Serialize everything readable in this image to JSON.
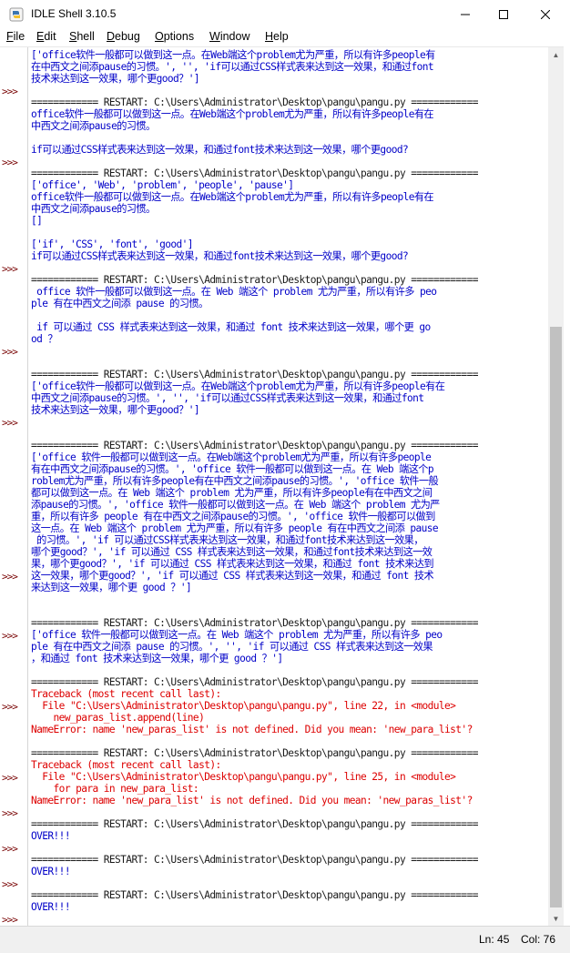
{
  "window": {
    "title": "IDLE Shell 3.10.5"
  },
  "window_controls": {
    "minimize": "—",
    "maximize": "☐",
    "close": "✕"
  },
  "menu": [
    {
      "label": "File",
      "key": "F",
      "rest": "ile"
    },
    {
      "label": "Edit",
      "key": "E",
      "rest": "dit"
    },
    {
      "label": "Shell",
      "key": "S",
      "rest": "hell"
    },
    {
      "label": "Debug",
      "key": "D",
      "rest": "ebug"
    },
    {
      "label": "Options",
      "key": "O",
      "rest": "ptions"
    },
    {
      "label": "Window",
      "key": "W",
      "rest": "indow"
    },
    {
      "label": "Help",
      "key": "H",
      "rest": "elp"
    }
  ],
  "prompt_symbol": ">>>",
  "prompts": [
    1,
    2,
    3,
    4,
    5,
    6,
    7,
    8,
    9,
    10,
    11,
    12,
    13,
    14,
    15,
    16
  ],
  "lines": [
    {
      "c": "blue",
      "t": "['office软件一般都可以做到这一点。在Web端这个problem尤为严重，所以有许多people有"
    },
    {
      "c": "blue",
      "t": "在中西文之间添pause的习惯。', '', 'if可以通过CSS样式表来达到这一效果，和通过font"
    },
    {
      "c": "blue",
      "t": "技术来达到这一效果，哪个更good？']"
    },
    {
      "c": "black",
      "t": ""
    },
    {
      "c": "black",
      "t": "============ RESTART: C:\\Users\\Administrator\\Desktop\\pangu\\pangu.py ============"
    },
    {
      "c": "blue",
      "t": "office软件一般都可以做到这一点。在Web端这个problem尤为严重，所以有许多people有在"
    },
    {
      "c": "blue",
      "t": "中西文之间添pause的习惯。"
    },
    {
      "c": "blue",
      "t": ""
    },
    {
      "c": "blue",
      "t": "if可以通过CSS样式表来达到这一效果，和通过font技术来达到这一效果，哪个更good?"
    },
    {
      "c": "black",
      "t": ""
    },
    {
      "c": "black",
      "t": "============ RESTART: C:\\Users\\Administrator\\Desktop\\pangu\\pangu.py ============"
    },
    {
      "c": "blue",
      "t": "['office', 'Web', 'problem', 'people', 'pause']"
    },
    {
      "c": "blue",
      "t": "office软件一般都可以做到这一点。在Web端这个problem尤为严重，所以有许多people有在"
    },
    {
      "c": "blue",
      "t": "中西文之间添pause的习惯。"
    },
    {
      "c": "blue",
      "t": "[]"
    },
    {
      "c": "blue",
      "t": ""
    },
    {
      "c": "blue",
      "t": "['if', 'CSS', 'font', 'good']"
    },
    {
      "c": "blue",
      "t": "if可以通过CSS样式表来达到这一效果，和通过font技术来达到这一效果，哪个更good?"
    },
    {
      "c": "black",
      "t": ""
    },
    {
      "c": "black",
      "t": "============ RESTART: C:\\Users\\Administrator\\Desktop\\pangu\\pangu.py ============"
    },
    {
      "c": "blue",
      "t": " office 软件一般都可以做到这一点。在 Web 端这个 problem 尤为严重，所以有许多 peo"
    },
    {
      "c": "blue",
      "t": "ple 有在中西文之间添 pause 的习惯。"
    },
    {
      "c": "blue",
      "t": ""
    },
    {
      "c": "blue",
      "t": " if 可以通过 CSS 样式表来达到这一效果，和通过 font 技术来达到这一效果，哪个更 go"
    },
    {
      "c": "blue",
      "t": "od ？"
    },
    {
      "c": "black",
      "t": ""
    },
    {
      "c": "black",
      "t": ""
    },
    {
      "c": "black",
      "t": "============ RESTART: C:\\Users\\Administrator\\Desktop\\pangu\\pangu.py ============"
    },
    {
      "c": "blue",
      "t": "['office软件一般都可以做到这一点。在Web端这个problem尤为严重，所以有许多people有在"
    },
    {
      "c": "blue",
      "t": "中西文之间添pause的习惯。', '', 'if可以通过CSS样式表来达到这一效果，和通过font"
    },
    {
      "c": "blue",
      "t": "技术来达到这一效果，哪个更good？']"
    },
    {
      "c": "black",
      "t": ""
    },
    {
      "c": "black",
      "t": ""
    },
    {
      "c": "black",
      "t": "============ RESTART: C:\\Users\\Administrator\\Desktop\\pangu\\pangu.py ============"
    },
    {
      "c": "blue",
      "t": "['office 软件一般都可以做到这一点。在Web端这个problem尤为严重，所以有许多people"
    },
    {
      "c": "blue",
      "t": "有在中西文之间添pause的习惯。', 'office 软件一般都可以做到这一点。在 Web 端这个p"
    },
    {
      "c": "blue",
      "t": "roblem尤为严重，所以有许多people有在中西文之间添pause的习惯。', 'office 软件一般"
    },
    {
      "c": "blue",
      "t": "都可以做到这一点。在 Web 端这个 problem 尤为严重，所以有许多people有在中西文之间"
    },
    {
      "c": "blue",
      "t": "添pause的习惯。', 'office 软件一般都可以做到这一点。在 Web 端这个 problem 尤为严"
    },
    {
      "c": "blue",
      "t": "重，所以有许多 people 有在中西文之间添pause的习惯。', 'office 软件一般都可以做到"
    },
    {
      "c": "blue",
      "t": "这一点。在 Web 端这个 problem 尤为严重，所以有许多 people 有在中西文之间添 pause"
    },
    {
      "c": "blue",
      "t": " 的习惯。', 'if 可以通过CSS样式表来达到这一效果，和通过font技术来达到这一效果，"
    },
    {
      "c": "blue",
      "t": "哪个更good？', 'if 可以通过 CSS 样式表来达到这一效果，和通过font技术来达到这一效"
    },
    {
      "c": "blue",
      "t": "果，哪个更good？', 'if 可以通过 CSS 样式表来达到这一效果，和通过 font 技术来达到"
    },
    {
      "c": "blue",
      "t": "这一效果，哪个更good？', 'if 可以通过 CSS 样式表来达到这一效果，和通过 font 技术"
    },
    {
      "c": "blue",
      "t": "来达到这一效果，哪个更 good ？']"
    },
    {
      "c": "black",
      "t": ""
    },
    {
      "c": "black",
      "t": ""
    },
    {
      "c": "black",
      "t": "============ RESTART: C:\\Users\\Administrator\\Desktop\\pangu\\pangu.py ============"
    },
    {
      "c": "blue",
      "t": "['office 软件一般都可以做到这一点。在 Web 端这个 problem 尤为严重，所以有许多 peo"
    },
    {
      "c": "blue",
      "t": "ple 有在中西文之间添 pause 的习惯。', '', 'if 可以通过 CSS 样式表来达到这一效果"
    },
    {
      "c": "blue",
      "t": "，和通过 font 技术来达到这一效果，哪个更 good ？']"
    },
    {
      "c": "black",
      "t": ""
    },
    {
      "c": "black",
      "t": "============ RESTART: C:\\Users\\Administrator\\Desktop\\pangu\\pangu.py ============"
    },
    {
      "c": "red",
      "t": "Traceback (most recent call last):"
    },
    {
      "c": "red",
      "t": "  File \"C:\\Users\\Administrator\\Desktop\\pangu\\pangu.py\", line 22, in <module>"
    },
    {
      "c": "red",
      "t": "    new_paras_list.append(line)"
    },
    {
      "c": "red",
      "t": "NameError: name 'new_paras_list' is not defined. Did you mean: 'new_para_list'?"
    },
    {
      "c": "black",
      "t": ""
    },
    {
      "c": "black",
      "t": "============ RESTART: C:\\Users\\Administrator\\Desktop\\pangu\\pangu.py ============"
    },
    {
      "c": "red",
      "t": "Traceback (most recent call last):"
    },
    {
      "c": "red",
      "t": "  File \"C:\\Users\\Administrator\\Desktop\\pangu\\pangu.py\", line 25, in <module>"
    },
    {
      "c": "red",
      "t": "    for para in new_para_list:"
    },
    {
      "c": "red",
      "t": "NameError: name 'new_para_list' is not defined. Did you mean: 'new_paras_list'?"
    },
    {
      "c": "black",
      "t": ""
    },
    {
      "c": "black",
      "t": "============ RESTART: C:\\Users\\Administrator\\Desktop\\pangu\\pangu.py ============"
    },
    {
      "c": "blue",
      "t": "OVER!!!"
    },
    {
      "c": "black",
      "t": ""
    },
    {
      "c": "black",
      "t": "============ RESTART: C:\\Users\\Administrator\\Desktop\\pangu\\pangu.py ============"
    },
    {
      "c": "blue",
      "t": "OVER!!!"
    },
    {
      "c": "black",
      "t": ""
    },
    {
      "c": "black",
      "t": "============ RESTART: C:\\Users\\Administrator\\Desktop\\pangu\\pangu.py ============"
    },
    {
      "c": "blue",
      "t": "OVER!!!"
    },
    {
      "c": "black",
      "t": ""
    },
    {
      "c": "black",
      "t": "============ RESTART: C:\\Users\\Administrator\\Desktop\\pangu\\pangu.py ============"
    },
    {
      "c": "blue",
      "t": "OVER!!!"
    }
  ],
  "status": {
    "line": "Ln: 45",
    "col": "Col: 76"
  },
  "colors": {
    "output": "#0000c8",
    "error": "#dd0000",
    "prompt": "#770000",
    "restart": "#1a1a1a"
  }
}
